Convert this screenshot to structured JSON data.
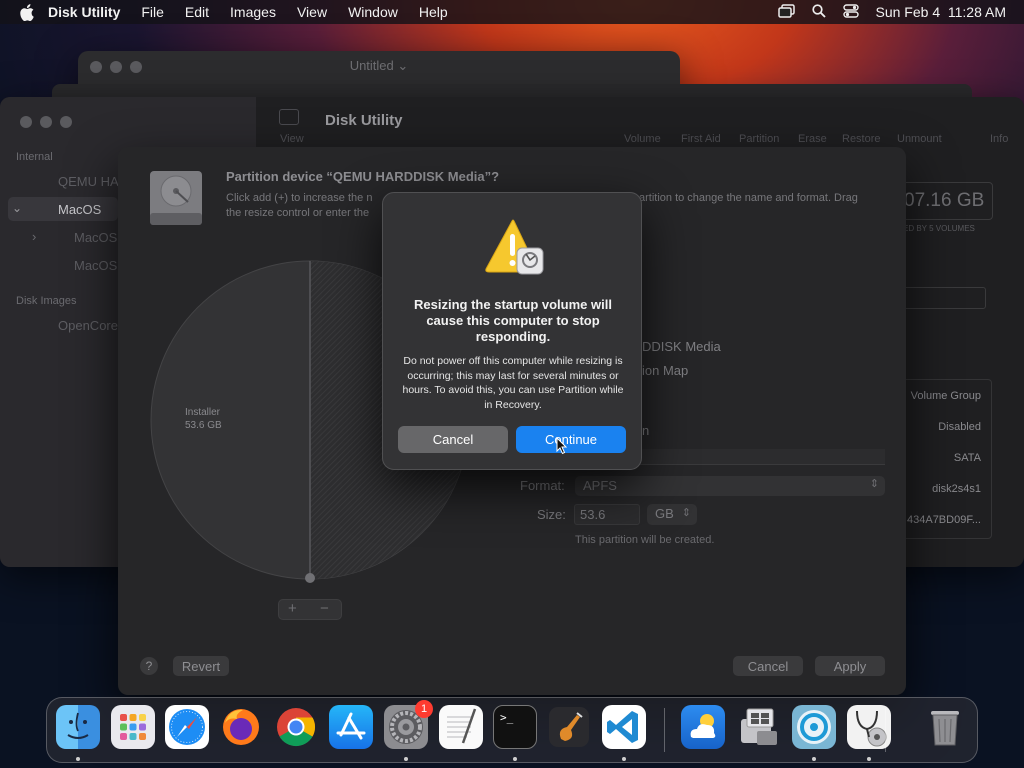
{
  "menubar": {
    "app_name": "Disk Utility",
    "menus": [
      "File",
      "Edit",
      "Images",
      "View",
      "Window",
      "Help"
    ],
    "datetime": "Sun Feb 4  11:28 AM"
  },
  "back_window": {
    "title": "Untitled"
  },
  "du_window": {
    "title": "Disk Utility",
    "view_label": "View",
    "toolbar": [
      "Volume",
      "First Aid",
      "Partition",
      "Erase",
      "Restore",
      "Unmount",
      "Info"
    ],
    "sidebar": {
      "internal_header": "Internal",
      "item_qemu": "QEMU HA",
      "item_macos": "MacOS",
      "item_macos_sub1": "MacOS",
      "item_macos_sub2": "MacOS",
      "disk_images_header": "Disk Images",
      "item_opencore": "OpenCore"
    },
    "capacity": "07.16 GB",
    "capacity_sub": "ED BY 5 VOLUMES",
    "info_rows": [
      "Volume Group",
      "Disabled",
      "SATA",
      "disk2s4s1",
      "434A7BD09F..."
    ]
  },
  "sheet": {
    "title": "Partition device “QEMU HARDDISK Media”?",
    "desc_line1_left": "Click add (+) to increase the n",
    "desc_line1_right": "artition to change the name and format. Drag",
    "desc_line2_left": "the resize control or enter the",
    "pie_label": "Installer",
    "pie_size": "53.6 GB",
    "add_symbol": "+",
    "remove_symbol": "−",
    "device_name": "DDISK Media",
    "scheme": "ion Map",
    "name_value": "n",
    "format_label": "Format:",
    "format_value": "APFS",
    "size_label": "Size:",
    "size_value": "53.6",
    "size_unit": "GB",
    "hint": "This partition will be created.",
    "help": "?",
    "revert": "Revert",
    "cancel": "Cancel",
    "apply": "Apply"
  },
  "alert": {
    "title": "Resizing the startup volume will cause this computer to stop responding.",
    "message": "Do not power off this computer while resizing is occurring; this may last for several minutes or hours. To avoid this, you can use Partition while in Recovery.",
    "cancel": "Cancel",
    "continue": "Continue"
  },
  "dock": {
    "settings_badge": "1",
    "terminal_prompt": ">_"
  },
  "colors": {
    "accent": "#1a82f0",
    "badge": "#ff3b30"
  }
}
